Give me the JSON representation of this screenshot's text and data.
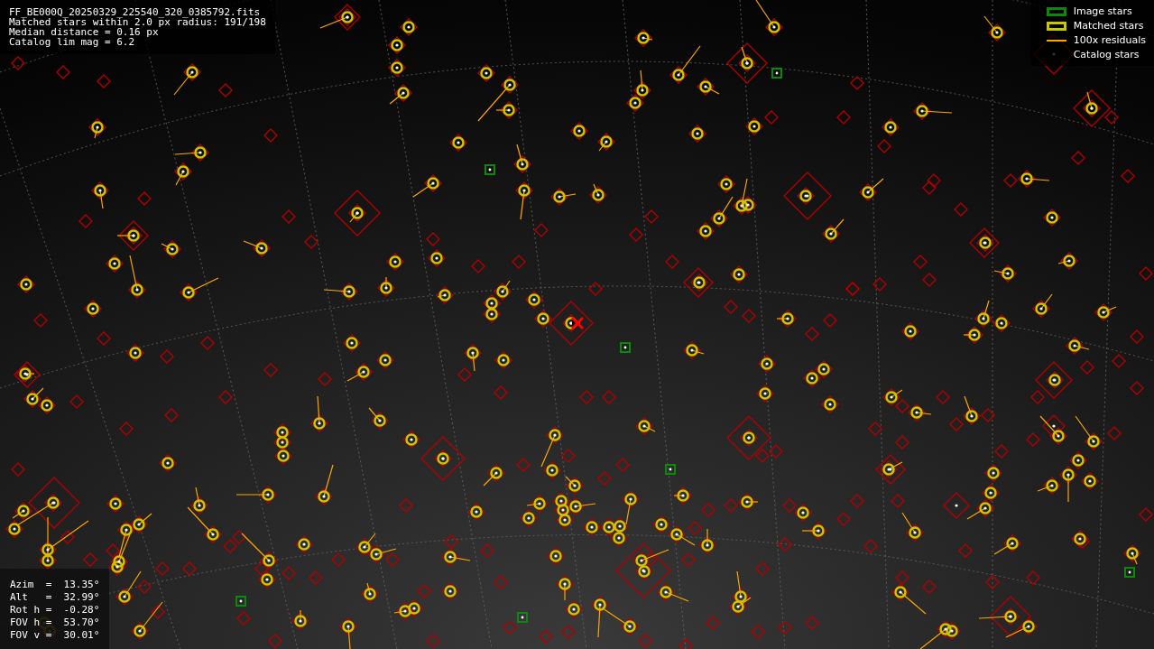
{
  "info": {
    "lines": [
      "FF_BE000Q_20250329_225540_320_0385792.fits",
      "Matched stars within 2.0 px radius: 191/198",
      "Median distance = 0.16 px",
      "Catalog lim mag = 6.2"
    ]
  },
  "legend": [
    {
      "kind": "image",
      "label": "Image stars",
      "color": "#0a8a0a"
    },
    {
      "kind": "matched",
      "label": "Matched stars",
      "color": "#c8c800"
    },
    {
      "kind": "residual",
      "label": "100x residuals",
      "color": "#ffa500"
    },
    {
      "kind": "catalog",
      "label": "Catalog stars"
    }
  ],
  "pointing": {
    "lines": [
      "Azim  =  13.35°",
      "Alt   =  32.99°",
      "Rot h =  -0.28°",
      "FOV h =  53.70°",
      "FOV v =  30.01°"
    ]
  }
}
